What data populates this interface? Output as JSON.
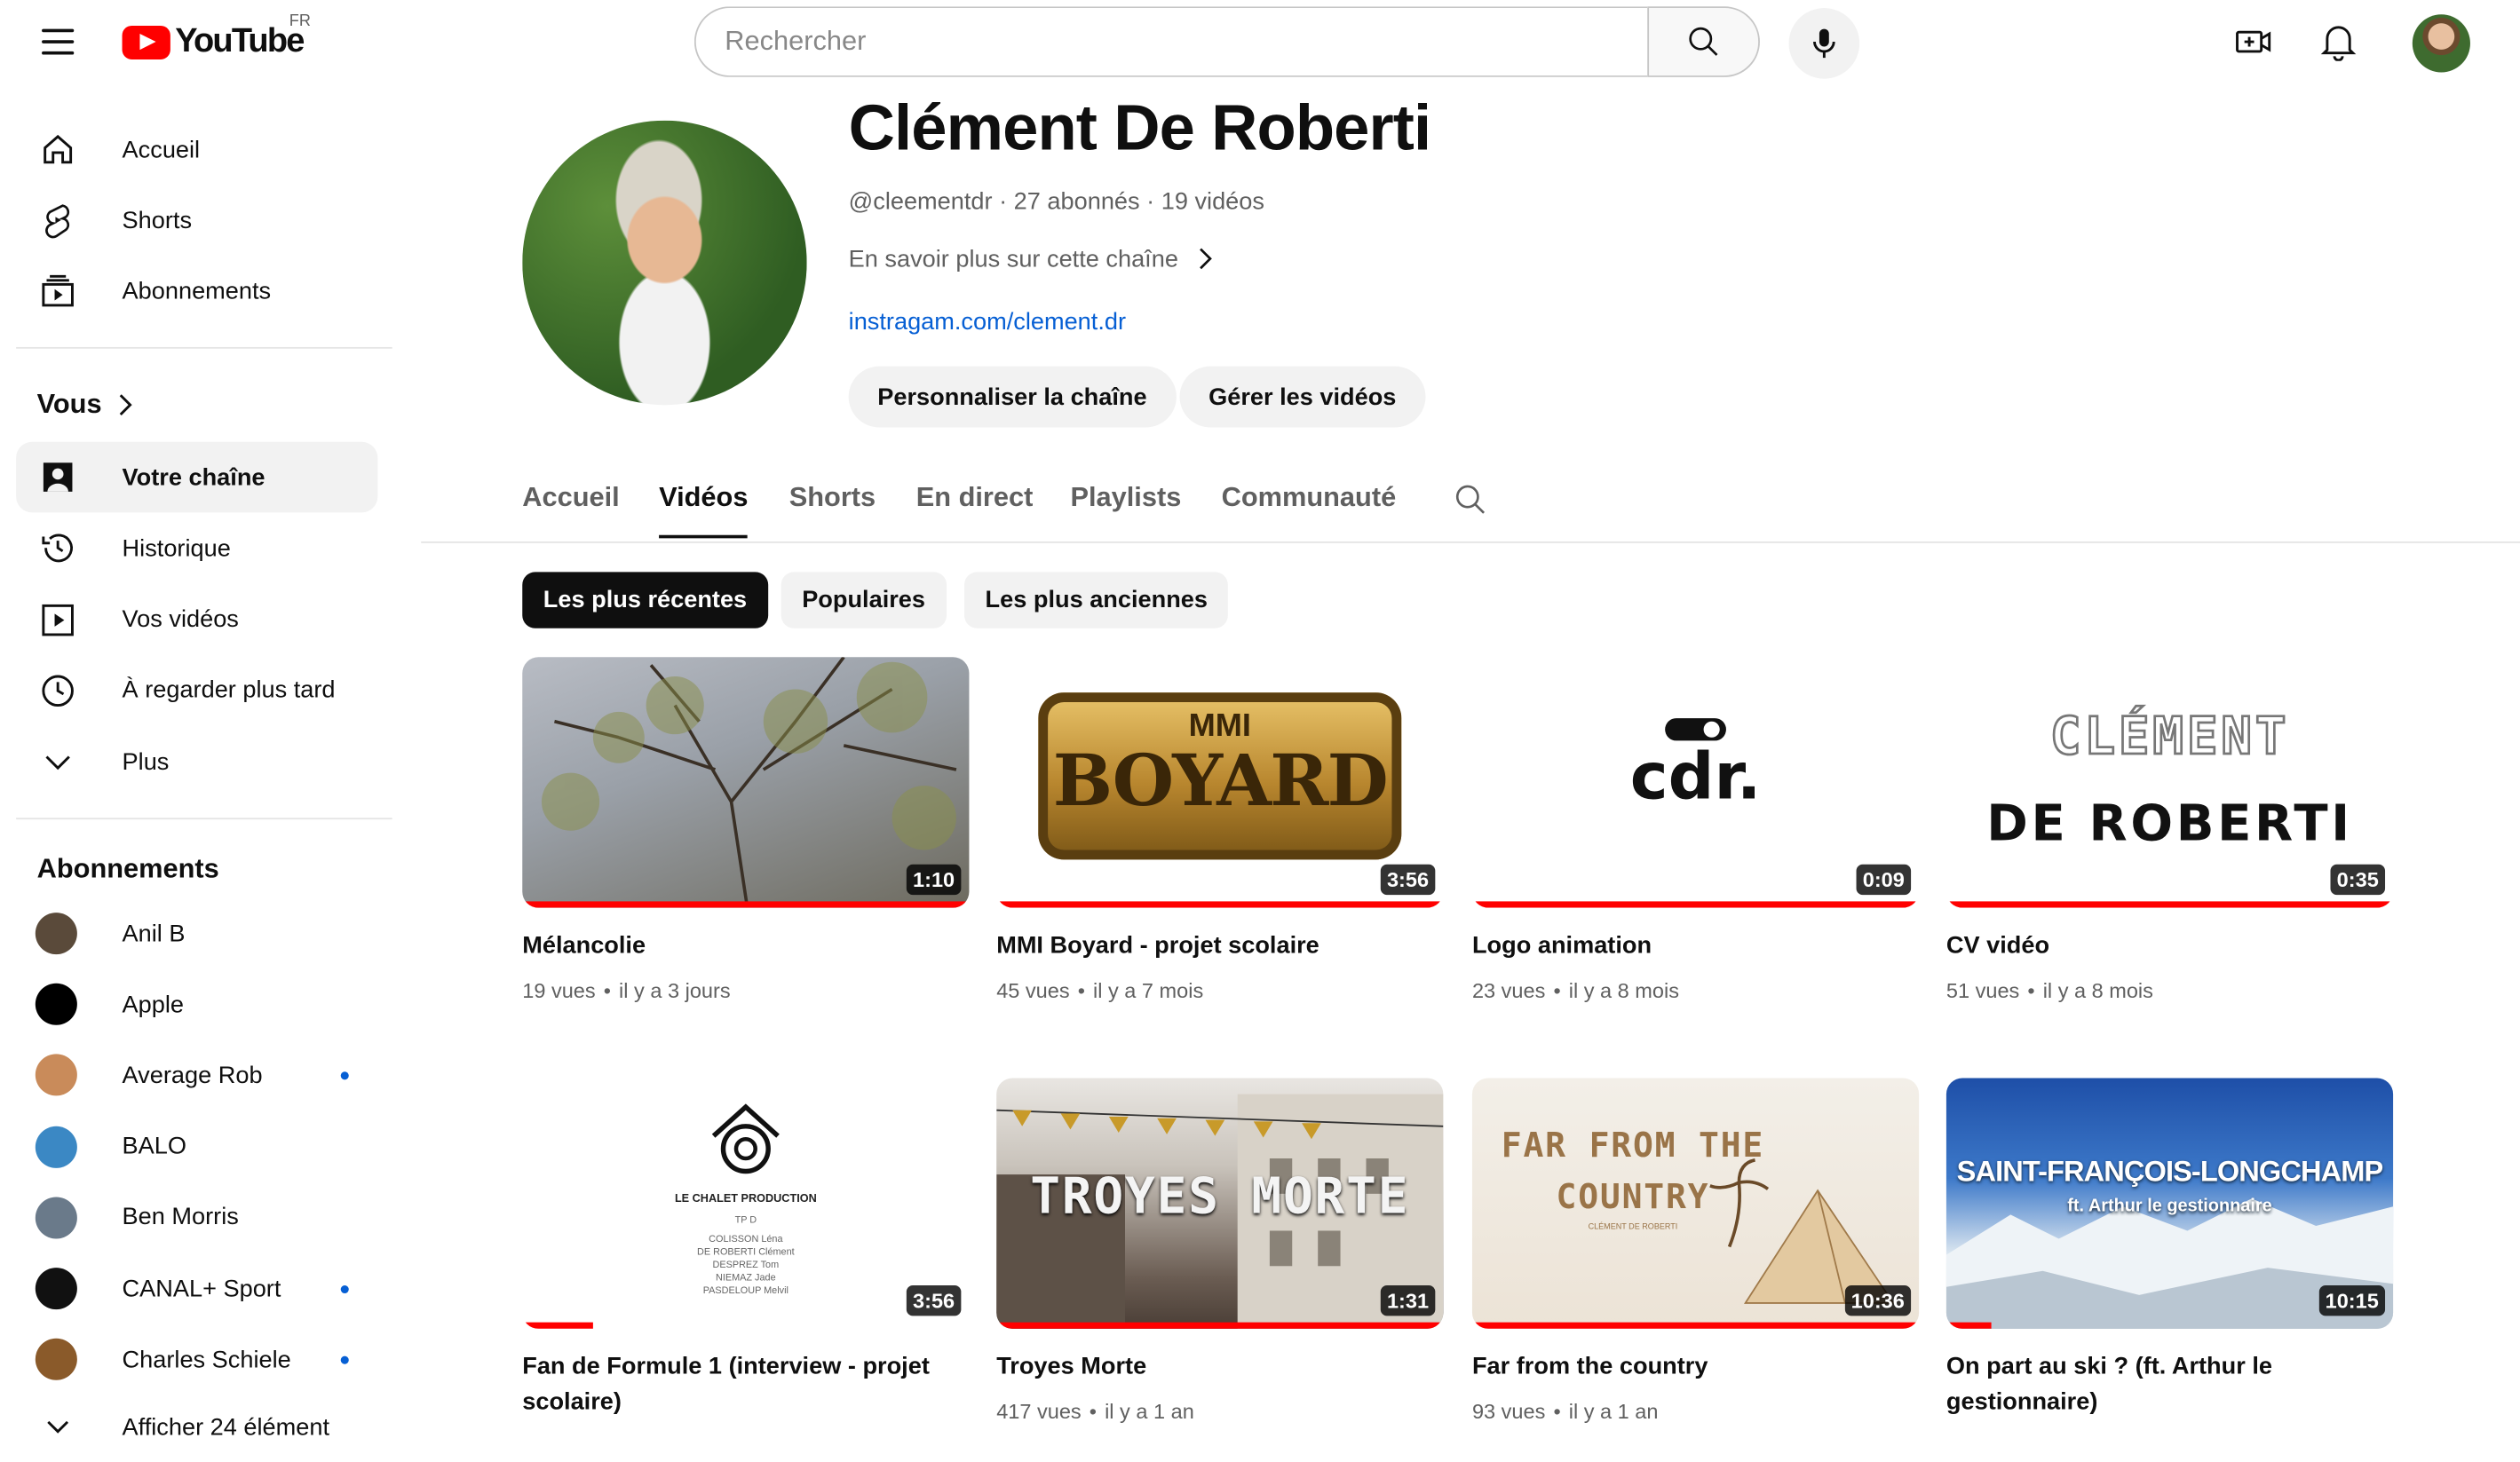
{
  "header": {
    "logo_text": "YouTube",
    "region": "FR",
    "search_placeholder": "Rechercher"
  },
  "sidebar": {
    "main": [
      {
        "label": "Accueil",
        "icon": "home-icon"
      },
      {
        "label": "Shorts",
        "icon": "shorts-icon"
      },
      {
        "label": "Abonnements",
        "icon": "subscriptions-icon"
      }
    ],
    "you_heading": "Vous",
    "you": [
      {
        "label": "Votre chaîne",
        "icon": "your-channel-icon",
        "active": true
      },
      {
        "label": "Historique",
        "icon": "history-icon"
      },
      {
        "label": "Vos vidéos",
        "icon": "your-videos-icon"
      },
      {
        "label": "À regarder plus tard",
        "icon": "watch-later-icon"
      },
      {
        "label": "Plus",
        "icon": "chevron-down-icon"
      }
    ],
    "subs_heading": "Abonnements",
    "subs": [
      {
        "name": "Anil B",
        "color": "#5a4a3a",
        "new": false
      },
      {
        "name": "Apple",
        "color": "#000000",
        "new": false
      },
      {
        "name": "Average Rob",
        "color": "#c98b5a",
        "new": true
      },
      {
        "name": "BALO",
        "color": "#3b88c4",
        "new": false
      },
      {
        "name": "Ben Morris",
        "color": "#6a7a8a",
        "new": false
      },
      {
        "name": "CANAL+ Sport",
        "color": "#111111",
        "new": true
      },
      {
        "name": "Charles Schiele",
        "color": "#8a5a2a",
        "new": true
      }
    ],
    "show_more": "Afficher 24 élément"
  },
  "channel": {
    "name": "Clément De Roberti",
    "meta": "@cleementdr · 27 abonnés · 19 vidéos",
    "more": "En savoir plus sur cette chaîne",
    "link": "instragam.com/clement.dr",
    "customize": "Personnaliser la chaîne",
    "manage": "Gérer les vidéos"
  },
  "tabs": [
    "Accueil",
    "Vidéos",
    "Shorts",
    "En direct",
    "Playlists",
    "Communauté"
  ],
  "chips": [
    "Les plus récentes",
    "Populaires",
    "Les plus anciennes"
  ],
  "videos": [
    {
      "title": "Mélancolie",
      "views": "19 vues",
      "age": "il y a 3 jours",
      "duration": "1:10",
      "progress": 1.0
    },
    {
      "title": "MMI Boyard - projet scolaire",
      "views": "45 vues",
      "age": "il y a 7 mois",
      "duration": "3:56",
      "progress": 1.0,
      "thumb_text_top": "MMI",
      "thumb_text": "BOYARD"
    },
    {
      "title": "Logo animation",
      "views": "23 vues",
      "age": "il y a 8 mois",
      "duration": "0:09",
      "progress": 1.0,
      "thumb_text": "cdr."
    },
    {
      "title": "CV vidéo",
      "views": "51 vues",
      "age": "il y a 8 mois",
      "duration": "0:35",
      "progress": 1.0,
      "thumb_text_top": "CLÉMENT",
      "thumb_text": "DE ROBERTI"
    },
    {
      "title": "Fan de Formule 1 (interview - projet scolaire)",
      "views": "",
      "age": "",
      "duration": "3:56",
      "progress": 0.16,
      "thumb_text_top": "LE CHALET PRODUCTION",
      "thumb_text": "TP D",
      "thumb_credits": [
        "COLISSON Léna",
        "DE ROBERTI Clément",
        "DESPREZ Tom",
        "NIEMAZ Jade",
        "PASDELOUP Melvil"
      ]
    },
    {
      "title": "Troyes Morte",
      "views": "417 vues",
      "age": "il y a 1 an",
      "duration": "1:31",
      "progress": 1.0,
      "thumb_text": "TROYES MORTE"
    },
    {
      "title": "Far from the country",
      "views": "93 vues",
      "age": "il y a 1 an",
      "duration": "10:36",
      "progress": 1.0,
      "thumb_text_top": "FAR FROM THE",
      "thumb_text": "COUNTRY",
      "thumb_sub": "CLÉMENT DE ROBERTI"
    },
    {
      "title": "On part au ski ? (ft. Arthur le gestionnaire)",
      "views": "",
      "age": "",
      "duration": "10:15",
      "progress": 0.1,
      "thumb_text_top": "SAINT-FRANÇOIS-LONGCHAMP",
      "thumb_text": "ft. Arthur le gestionnaire"
    }
  ],
  "colors": {
    "accent": "#ff0000",
    "link": "#065fd4",
    "muted": "#606060"
  }
}
